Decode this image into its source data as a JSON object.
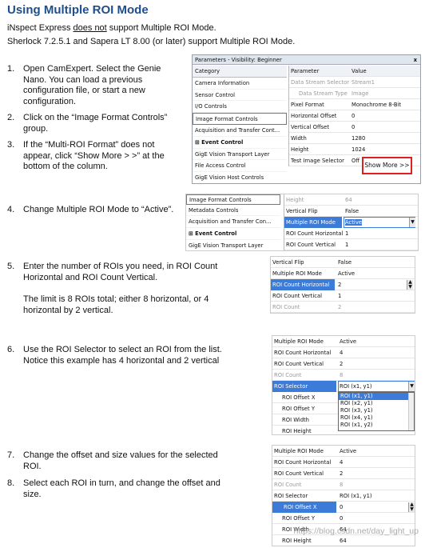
{
  "title": "Using Multiple ROI Mode",
  "intro": {
    "line1_pre": "iNspect Express ",
    "line1_underline": "does not",
    "line1_post": " support Multiple ROI Mode.",
    "line2": "Sherlock 7.2.5.1 and Sapera LT 8.00 (or later) support Multiple ROI Mode."
  },
  "steps": [
    {
      "num": "1.",
      "lines": [
        "Open CamExpert. Select the Genie",
        "Nano. You can load a previous",
        "configuration file, or start a new",
        "configuration."
      ]
    },
    {
      "num": "2.",
      "lines": [
        "Click on the “Image Format Controls”",
        "group."
      ]
    },
    {
      "num": "3.",
      "lines": [
        "If the “Multi-ROI Format” does not",
        "appear, click “Show More > >” at the",
        "bottom of the column."
      ]
    },
    {
      "num": "4.",
      "lines": [
        "Change Multiple ROI Mode to “Active”."
      ]
    },
    {
      "num": "5.",
      "lines": [
        "Enter the number of ROIs you need, in ROI Count",
        "Horizontal and ROI Count Vertical."
      ]
    },
    {
      "num": "",
      "lines": [
        "The limit is 8 ROIs total; either 8 horizontal, or 4",
        "horizontal by 2 vertical."
      ]
    },
    {
      "num": "6.",
      "lines": [
        "Use the ROI Selector to select an ROI from the list.",
        "Notice this example has 4 horizontal and 2 vertical"
      ]
    },
    {
      "num": "7.",
      "lines": [
        "Change the offset and size values for the selected",
        "ROI."
      ]
    },
    {
      "num": "8.",
      "lines": [
        "Select each ROI in turn, and change the offset and",
        "size."
      ]
    }
  ],
  "panel1": {
    "title": "Parameters - Visibility: Beginner",
    "close": "x",
    "category_header": "Category",
    "categories": [
      "Camera Information",
      "Sensor Control",
      "I/O Controls",
      "Image Format Controls",
      "Acquisition and Transfer Cont...",
      "Event Control",
      "GigE Vision Transport Layer",
      "File Access Control",
      "GigE Vision Host Controls"
    ],
    "param_header": "Parameter",
    "value_header": "Value",
    "params": [
      {
        "k": "Data Stream Selector",
        "v": "Stream1",
        "grey": true
      },
      {
        "k": "Data Stream Type",
        "v": "Image",
        "grey": true
      },
      {
        "k": "Pixel Format",
        "v": "Monochrome 8-Bit",
        "grey": false
      },
      {
        "k": "Horizontal Offset",
        "v": "0",
        "grey": false
      },
      {
        "k": "Vertical Offset",
        "v": "0",
        "grey": false
      },
      {
        "k": "Width",
        "v": "1280",
        "grey": false
      },
      {
        "k": "Height",
        "v": "1024",
        "grey": false
      },
      {
        "k": "Test Image Selector",
        "v": "Off",
        "grey": false
      }
    ],
    "show_more": "Show More >>"
  },
  "panel2": {
    "categories": [
      "Image Format Controls",
      "Metadata Controls",
      "Acquisition and Transfer Con...",
      "Event Control",
      "GigE Vision Transport Layer"
    ],
    "params": [
      {
        "k": "Height",
        "v": "64",
        "grey": true
      },
      {
        "k": "Vertical Flip",
        "v": "False",
        "grey": false
      },
      {
        "k": "Multiple ROI Mode",
        "v": "Active",
        "grey": false
      },
      {
        "k": "ROI Count Horizontal",
        "v": "1",
        "grey": false
      },
      {
        "k": "ROI Count Vertical",
        "v": "1",
        "grey": false
      }
    ]
  },
  "panel3": {
    "params": [
      {
        "k": "Vertical Flip",
        "v": "False"
      },
      {
        "k": "Multiple ROI Mode",
        "v": "Active"
      },
      {
        "k": "ROI Count Horizontal",
        "v": "2"
      },
      {
        "k": "ROI Count Vertical",
        "v": "1"
      },
      {
        "k": "ROI Count",
        "v": "2"
      }
    ]
  },
  "panel4": {
    "params": [
      {
        "k": "Multiple ROI Mode",
        "v": "Active"
      },
      {
        "k": "ROI Count Horizontal",
        "v": "4"
      },
      {
        "k": "ROI Count Vertical",
        "v": "2"
      },
      {
        "k": "ROI Count",
        "v": "8"
      },
      {
        "k": "ROI Selector",
        "v": "ROI (x1, y1)"
      },
      {
        "k": "ROI Offset X",
        "v": ""
      },
      {
        "k": "ROI Offset Y",
        "v": ""
      },
      {
        "k": "ROI Width",
        "v": ""
      },
      {
        "k": "ROI Height",
        "v": ""
      }
    ],
    "options": [
      "ROI (x1, y1)",
      "ROI (x2, y1)",
      "ROI (x3, y1)",
      "ROI (x4, y1)",
      "ROI (x1, y2)"
    ]
  },
  "panel5": {
    "params": [
      {
        "k": "Multiple ROI Mode",
        "v": "Active"
      },
      {
        "k": "ROI Count Horizontal",
        "v": "4"
      },
      {
        "k": "ROI Count Vertical",
        "v": "2"
      },
      {
        "k": "ROI Count",
        "v": "8"
      },
      {
        "k": "ROI Selector",
        "v": "ROI (x1, y1)"
      },
      {
        "k": "ROI Offset X",
        "v": "0"
      },
      {
        "k": "ROI Offset Y",
        "v": "0"
      },
      {
        "k": "ROI Width",
        "v": "64"
      },
      {
        "k": "ROI Height",
        "v": "64"
      }
    ]
  },
  "watermark": "https://blog.csdn.net/day_light_up"
}
